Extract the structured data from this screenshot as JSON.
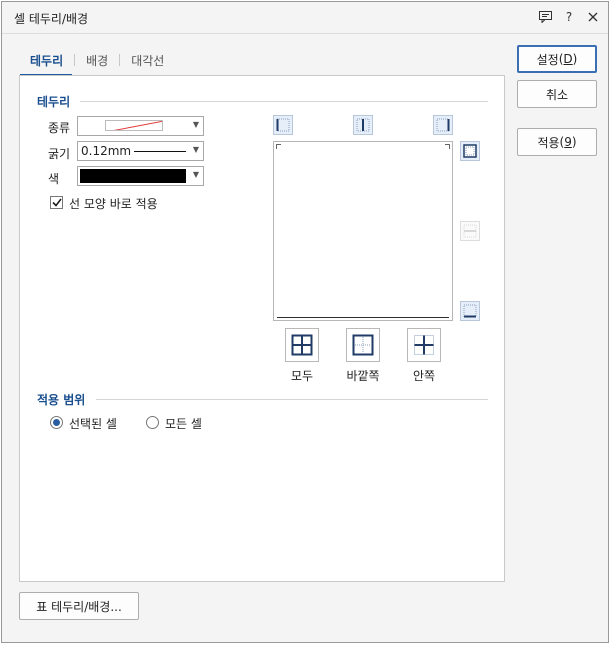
{
  "window": {
    "title": "셀 테두리/배경"
  },
  "tabs": [
    {
      "label": "테두리",
      "active": true
    },
    {
      "label": "배경",
      "active": false
    },
    {
      "label": "대각선",
      "active": false
    }
  ],
  "border_section": {
    "title": "테두리",
    "type_label": "종류",
    "thickness_label": "굵기",
    "thickness_value": "0.12mm",
    "color_label": "색",
    "color_value": "#000000",
    "apply_immediately_label": "선 모양 바로 적용",
    "apply_immediately_checked": true
  },
  "presets": {
    "all_label": "모두",
    "outside_label": "바깥쪽",
    "inside_label": "안쪽"
  },
  "scope_section": {
    "title": "적용 범위",
    "options": [
      {
        "label": "선택된 셀",
        "selected": true
      },
      {
        "label": "모든 셀",
        "selected": false
      }
    ]
  },
  "buttons": {
    "ok_label": "설정",
    "ok_mnemonic": "D",
    "cancel_label": "취소",
    "apply_label": "적용",
    "apply_mnemonic": "9",
    "table_border_label": "표 테두리/배경..."
  },
  "colors": {
    "accent": "#1a4f8f",
    "tab_underline": "#1a5aa6"
  }
}
